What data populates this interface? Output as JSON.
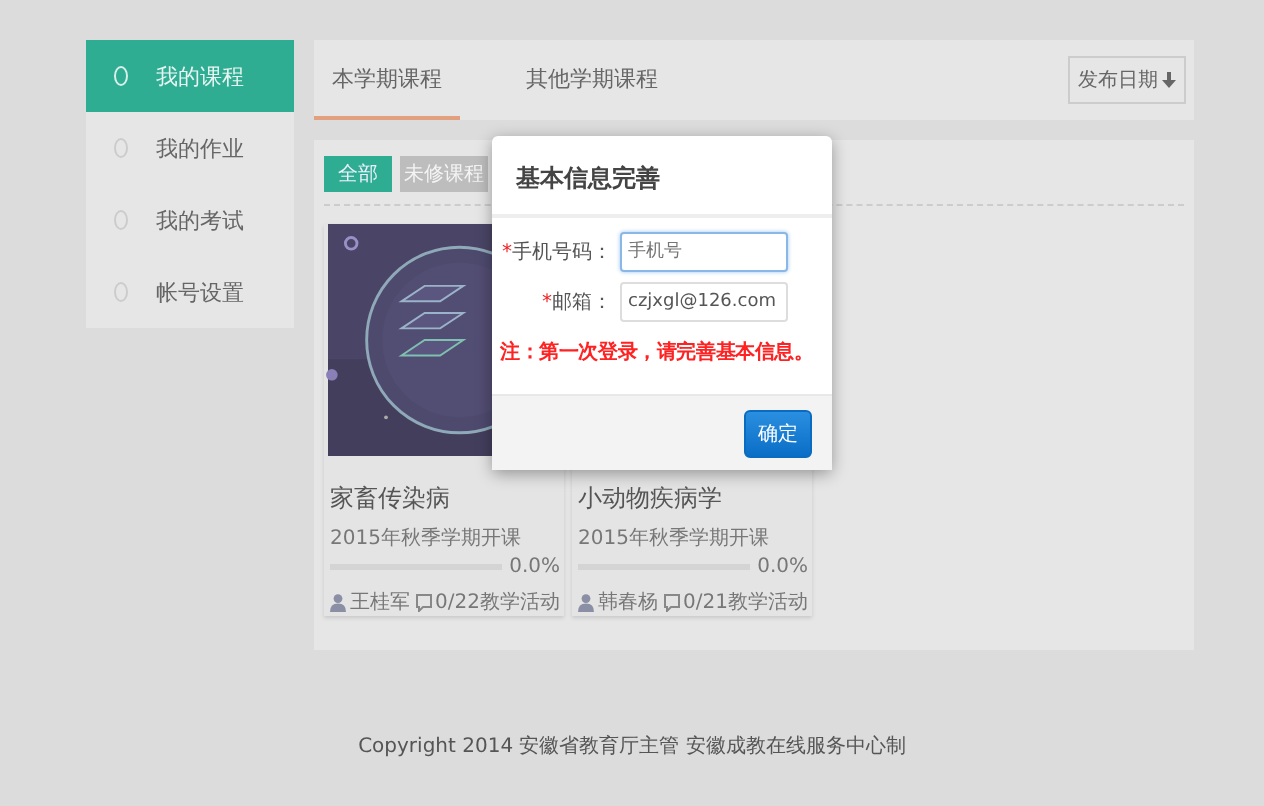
{
  "sidebar": {
    "items": [
      {
        "label": "我的课程",
        "selected": true
      },
      {
        "label": "我的作业",
        "selected": false
      },
      {
        "label": "我的考试",
        "selected": false
      },
      {
        "label": "帐号设置",
        "selected": false
      }
    ]
  },
  "tabs": [
    {
      "label": "本学期课程",
      "selected": true
    },
    {
      "label": "其他学期课程",
      "selected": false
    }
  ],
  "sort_button": {
    "label": "发布日期"
  },
  "filters": [
    {
      "label": "全部",
      "selected": true
    },
    {
      "label": "未修课程",
      "selected": false
    }
  ],
  "courses": [
    {
      "title": "家畜传染病",
      "term": "2015年秋季学期开课",
      "level": 0,
      "progress": "0.0%",
      "teacher": "王桂军",
      "activities": "0/22教学活动"
    },
    {
      "title": "小动物疾病学",
      "term": "2015年秋季学期开课",
      "level": 0,
      "progress": "0.0%",
      "teacher": "韩春杨",
      "activities": "0/21教学活动"
    }
  ],
  "modal": {
    "title": "基本信息完善",
    "fields": [
      {
        "mark": "*",
        "label": "手机号码：",
        "placeholder": "手机号",
        "focused": true
      },
      {
        "mark": "*",
        "label": "邮箱：",
        "value": "czjxgl@126.com",
        "focused": false
      }
    ],
    "note": "注：第一次登录，请完善基本信息。",
    "button": "确定"
  },
  "footer": "Copyright 2014 安徽省教育厅主管 安徽成教在线服务中心制"
}
